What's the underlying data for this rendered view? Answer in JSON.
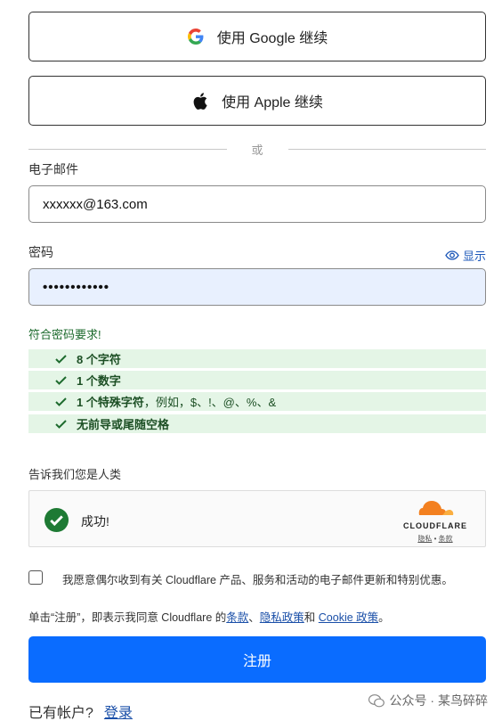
{
  "oauth": {
    "google_label": "使用 Google 继续",
    "apple_label": "使用 Apple 继续"
  },
  "divider_text": "或",
  "email": {
    "label": "电子邮件",
    "value": "xxxxxx@163.com"
  },
  "password": {
    "label": "密码",
    "show_label": "显示",
    "value": "••••••••••••"
  },
  "requirements": {
    "title": "符合密码要求!",
    "items": [
      {
        "bold": "8 个字符",
        "rest": ""
      },
      {
        "bold": "1 个数字",
        "rest": ""
      },
      {
        "bold": "1 个特殊字符",
        "rest": "，例如，$、!、@、%、&"
      },
      {
        "bold": "无前导或尾随空格",
        "rest": ""
      }
    ]
  },
  "captcha": {
    "prompt": "告诉我们您是人类",
    "status": "成功!",
    "brand": "CLOUDFLARE",
    "privacy": "隐私",
    "sep": " • ",
    "terms": "条款"
  },
  "marketing": {
    "label": "我愿意偶尔收到有关 Cloudflare 产品、服务和活动的电子邮件更新和特别优惠。"
  },
  "terms_line": {
    "prefix": "单击“注册”，即表示我同意 Cloudflare 的",
    "terms_link": "条款",
    "sep1": "、",
    "privacy_link": "隐私政策",
    "sep2": "和 ",
    "cookie_link": "Cookie 政策",
    "suffix": "。"
  },
  "submit_label": "注册",
  "login": {
    "prompt": "已有帐户?",
    "link": "登录"
  },
  "watermark": "公众号 · 某鸟碎碎",
  "colors": {
    "primary": "#0a6cff",
    "success": "#1e7a34",
    "cloudflare_orange": "#f38020"
  }
}
